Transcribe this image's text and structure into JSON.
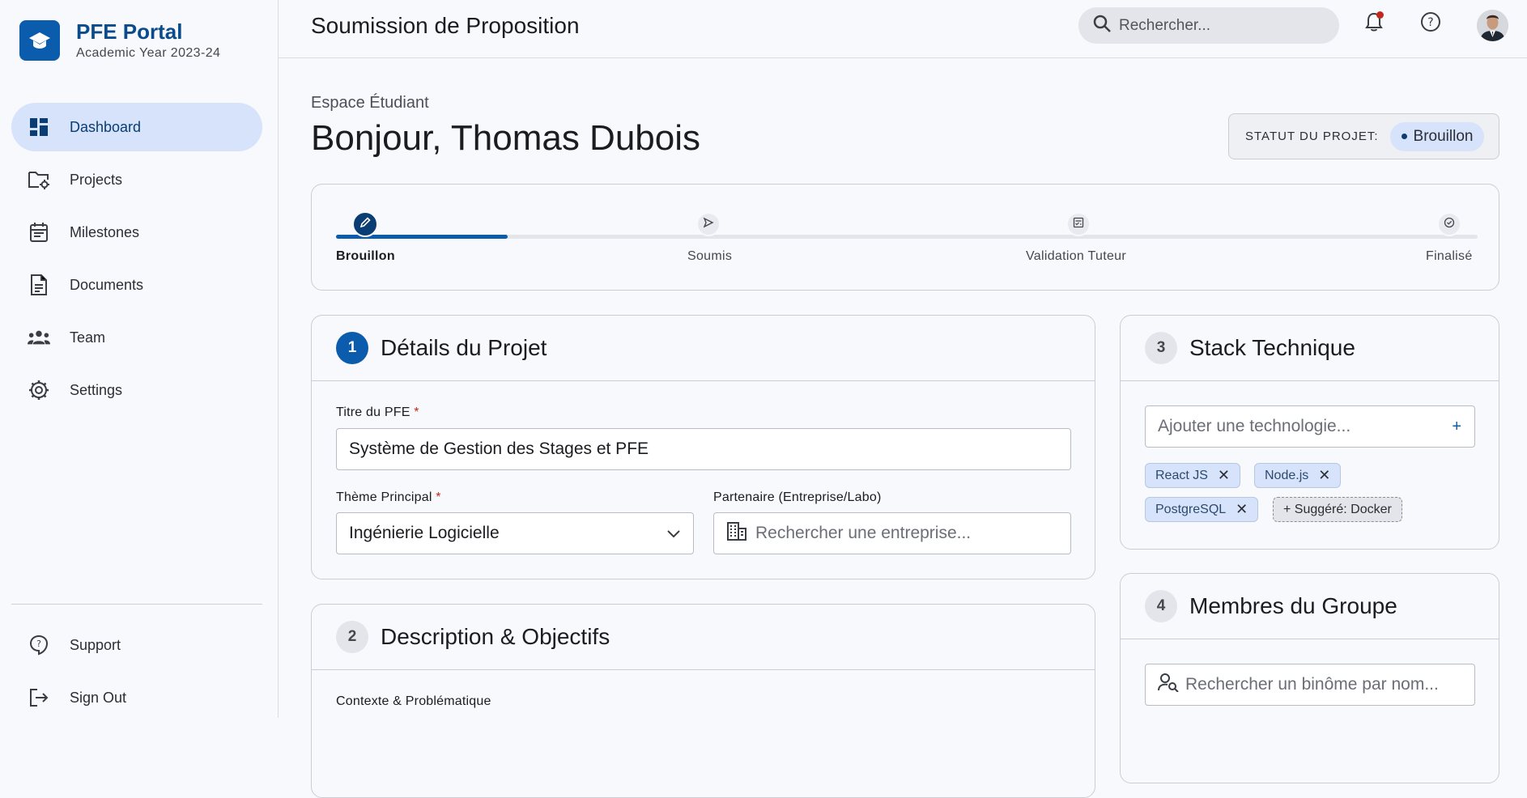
{
  "brand": {
    "title": "PFE Portal",
    "subtitle": "Academic Year 2023-24"
  },
  "sidebar": {
    "items": [
      {
        "label": "Dashboard",
        "icon": "dashboard-icon",
        "active": true
      },
      {
        "label": "Projects",
        "icon": "folder-gear-icon"
      },
      {
        "label": "Milestones",
        "icon": "calendar-icon"
      },
      {
        "label": "Documents",
        "icon": "document-icon"
      },
      {
        "label": "Team",
        "icon": "team-icon"
      },
      {
        "label": "Settings",
        "icon": "gear-icon"
      }
    ],
    "bottom": [
      {
        "label": "Support",
        "icon": "help-circle-icon"
      },
      {
        "label": "Sign Out",
        "icon": "logout-icon"
      }
    ]
  },
  "header": {
    "title": "Soumission de Proposition",
    "search_placeholder": "Rechercher..."
  },
  "page": {
    "eyebrow": "Espace Étudiant",
    "greeting": "Bonjour, Thomas Dubois",
    "status_label": "STATUT DU PROJET:",
    "status_value": "Brouillon"
  },
  "stepper": {
    "progress": 0.15,
    "steps": [
      {
        "label": "Brouillon",
        "icon": "pencil-icon",
        "active": true
      },
      {
        "label": "Soumis",
        "icon": "send-icon"
      },
      {
        "label": "Validation Tuteur",
        "icon": "review-icon"
      },
      {
        "label": "Finalisé",
        "icon": "check-circle-icon"
      }
    ]
  },
  "details": {
    "number": "1",
    "title": "Détails du Projet",
    "title_label": "Titre du PFE",
    "title_value": "Système de Gestion des Stages et PFE",
    "theme_label": "Thème Principal",
    "theme_value": "Ingénierie Logicielle",
    "partner_label": "Partenaire (Entreprise/Labo)",
    "partner_placeholder": "Rechercher une entreprise...",
    "required_mark": "*"
  },
  "description": {
    "number": "2",
    "title": "Description & Objectifs",
    "context_label": "Contexte & Problématique"
  },
  "stack": {
    "number": "3",
    "title": "Stack Technique",
    "input_placeholder": "Ajouter une technologie...",
    "add_symbol": "+",
    "chips": [
      "React JS",
      "Node.js",
      "PostgreSQL"
    ],
    "suggestion": "+ Suggéré: Docker"
  },
  "members": {
    "number": "4",
    "title": "Membres du Groupe",
    "search_placeholder": "Rechercher un binôme par nom..."
  }
}
